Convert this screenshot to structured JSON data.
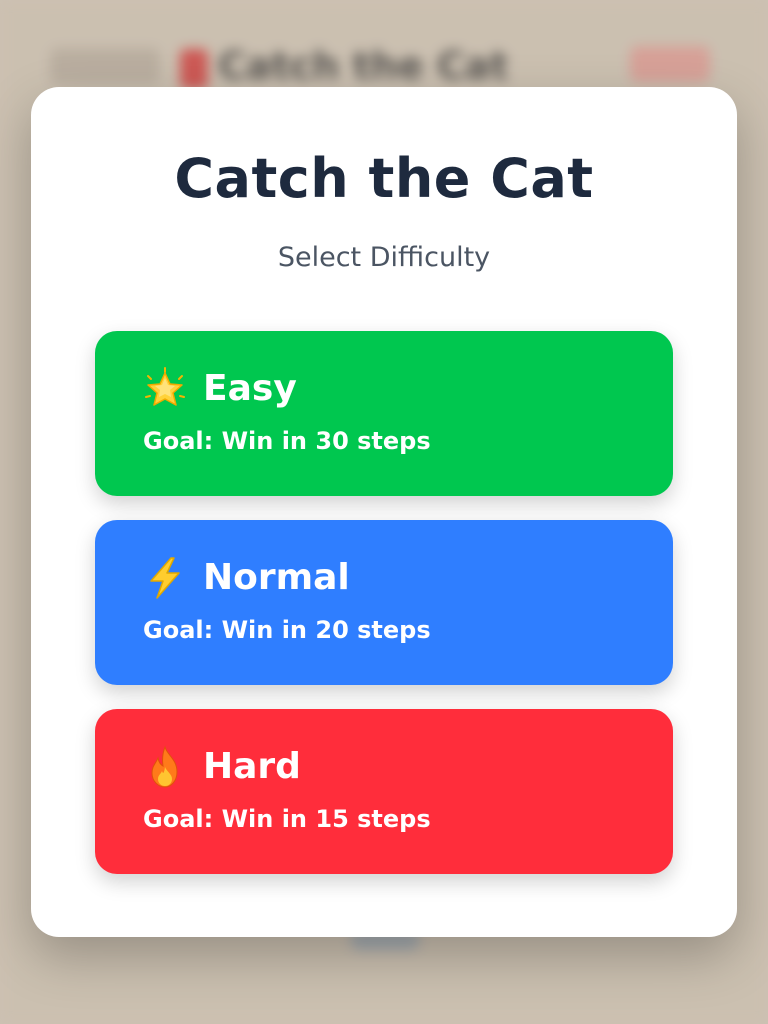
{
  "background": {
    "header_title": "Catch the Cat"
  },
  "modal": {
    "title": "Catch the Cat",
    "subtitle": "Select Difficulty",
    "options": [
      {
        "name": "Easy",
        "goal": "Goal: Win in 30 steps",
        "icon": "star-icon",
        "color": "#00c74f"
      },
      {
        "name": "Normal",
        "goal": "Goal: Win in 20 steps",
        "icon": "lightning-icon",
        "color": "#2f7eff"
      },
      {
        "name": "Hard",
        "goal": "Goal: Win in 15 steps",
        "icon": "fire-icon",
        "color": "#ff2d3b"
      }
    ]
  }
}
